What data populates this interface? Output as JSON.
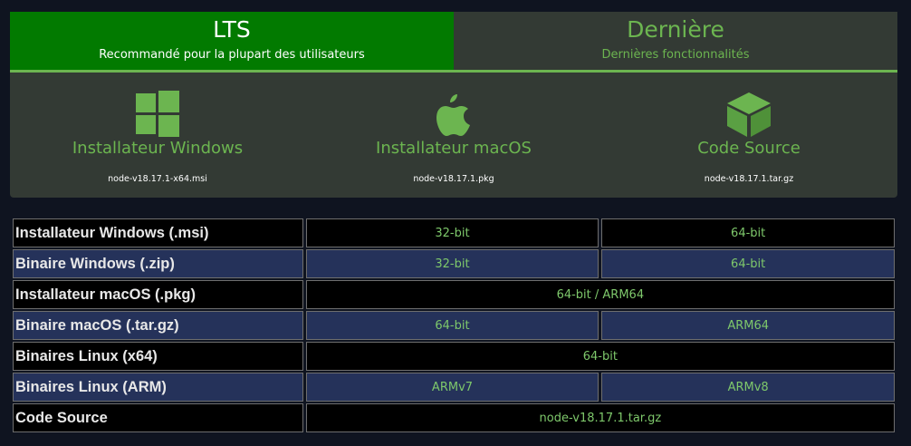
{
  "colors": {
    "page_bg": "#0f1420",
    "lts_tab_bg": "#027a00",
    "panel_bg": "#333a34",
    "accent_green": "#6cb550",
    "row_dark": "#000000",
    "row_blue": "#25325a"
  },
  "tabs": {
    "lts": {
      "title": "LTS",
      "subtitle": "Recommandé pour la plupart des utilisateurs",
      "active": true
    },
    "latest": {
      "title": "Dernière",
      "subtitle": "Dernières fonctionnalités",
      "active": false
    }
  },
  "downloads": [
    {
      "icon": "windows-icon",
      "label": "Installateur Windows",
      "file": "node-v18.17.1-x64.msi"
    },
    {
      "icon": "apple-icon",
      "label": "Installateur macOS",
      "file": "node-v18.17.1.pkg"
    },
    {
      "icon": "cube-icon",
      "label": "Code Source",
      "file": "node-v18.17.1.tar.gz"
    }
  ],
  "table": {
    "rows": [
      {
        "label": "Installateur Windows (.msi)",
        "links": [
          "32-bit",
          "64-bit"
        ]
      },
      {
        "label": "Binaire Windows (.zip)",
        "links": [
          "32-bit",
          "64-bit"
        ]
      },
      {
        "label": "Installateur macOS (.pkg)",
        "links": [
          "64-bit / ARM64"
        ]
      },
      {
        "label": "Binaire macOS (.tar.gz)",
        "links": [
          "64-bit",
          "ARM64"
        ]
      },
      {
        "label": "Binaires Linux (x64)",
        "links": [
          "64-bit"
        ]
      },
      {
        "label": "Binaires Linux (ARM)",
        "links": [
          "ARMv7",
          "ARMv8"
        ]
      },
      {
        "label": "Code Source",
        "links": [
          "node-v18.17.1.tar.gz"
        ]
      }
    ]
  }
}
